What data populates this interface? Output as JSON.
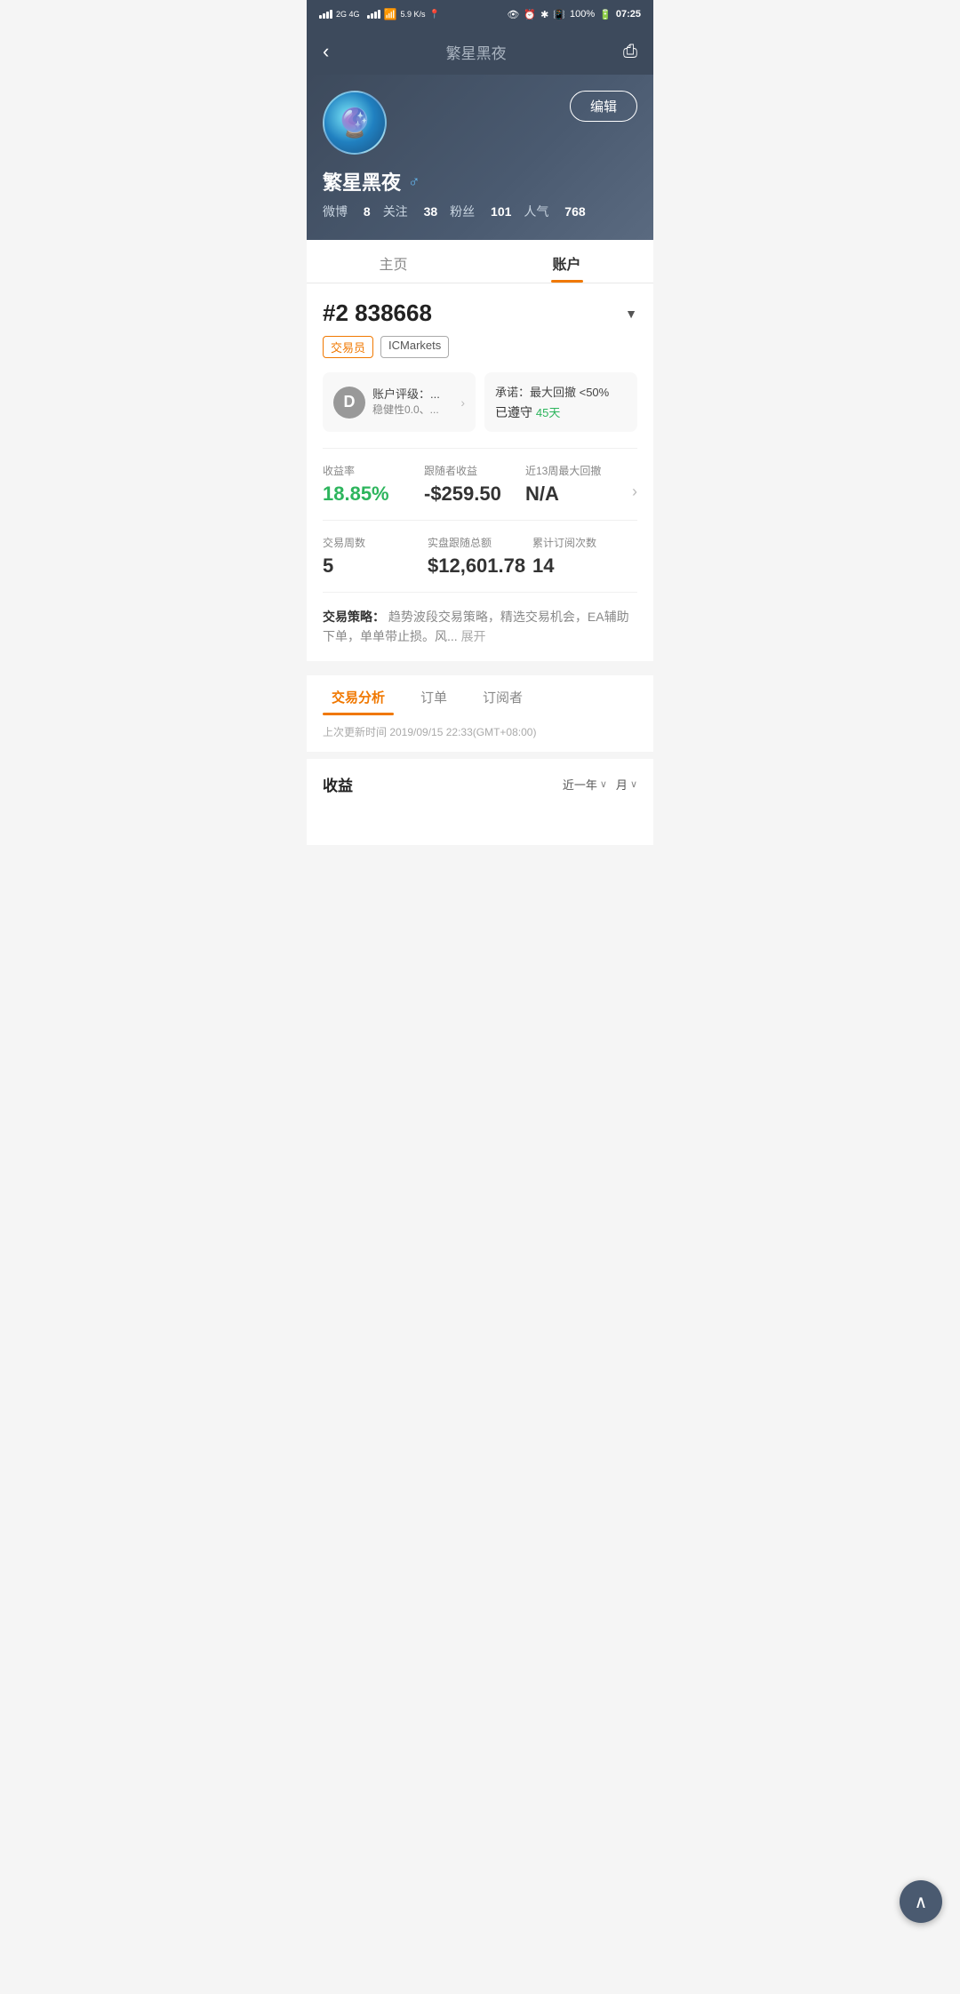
{
  "statusBar": {
    "leftText": "2G  4G",
    "speed": "5.9 K/s",
    "time": "07:25",
    "battery": "100%"
  },
  "navBar": {
    "backIcon": "‹",
    "title": "繁星黑夜",
    "shareIcon": "⎙"
  },
  "profile": {
    "name": "繁星黑夜",
    "genderIcon": "♂",
    "editButton": "编辑",
    "stats": {
      "weibo": "微博",
      "weiboCount": "8",
      "follow": "关注",
      "followCount": "38",
      "fans": "粉丝",
      "fansCount": "101",
      "popularity": "人气",
      "popularityCount": "768"
    }
  },
  "tabs": [
    {
      "label": "主页",
      "active": false
    },
    {
      "label": "账户",
      "active": true
    }
  ],
  "accountSection": {
    "accountId": "#2 838668",
    "dropdownArrow": "▼",
    "badges": [
      {
        "label": "交易员",
        "type": "trader"
      },
      {
        "label": "ICMarkets",
        "type": "platform"
      }
    ],
    "gradeCard": {
      "grade": "D",
      "title": "账户评级：...",
      "subtitle": "稳健性0.0、..."
    },
    "promiseCard": {
      "title": "承诺：最大回撤 <50%",
      "daysLabel": "已遵守",
      "days": "45天"
    },
    "statsRow1": [
      {
        "label": "收益率",
        "value": "18.85%",
        "color": "green"
      },
      {
        "label": "跟随者收益",
        "value": "-$259.50",
        "color": "dark"
      },
      {
        "label": "近13周最大回撤",
        "value": "N/A",
        "color": "dark"
      }
    ],
    "statsRow2": [
      {
        "label": "交易周数",
        "value": "5",
        "color": "dark"
      },
      {
        "label": "实盘跟随总额",
        "value": "$12,601.78",
        "color": "dark"
      },
      {
        "label": "累计订阅次数",
        "value": "14",
        "color": "dark"
      }
    ],
    "strategy": {
      "labelText": "交易策略：",
      "content": "趋势波段交易策略，精选交易机会，EA辅助下单，单单带止损。风...",
      "expandText": "展开"
    }
  },
  "analysisTabs": [
    {
      "label": "交易分析",
      "active": true
    },
    {
      "label": "订单",
      "active": false
    },
    {
      "label": "订阅者",
      "active": false
    }
  ],
  "updateTime": "上次更新时间 2019/09/15 22:33(GMT+08:00)",
  "profitSection": {
    "title": "收益",
    "periodLabel": "近一年",
    "periodArrow": "∨",
    "unitLabel": "月",
    "unitArrow": "∨"
  },
  "scrollUpButton": "∧"
}
